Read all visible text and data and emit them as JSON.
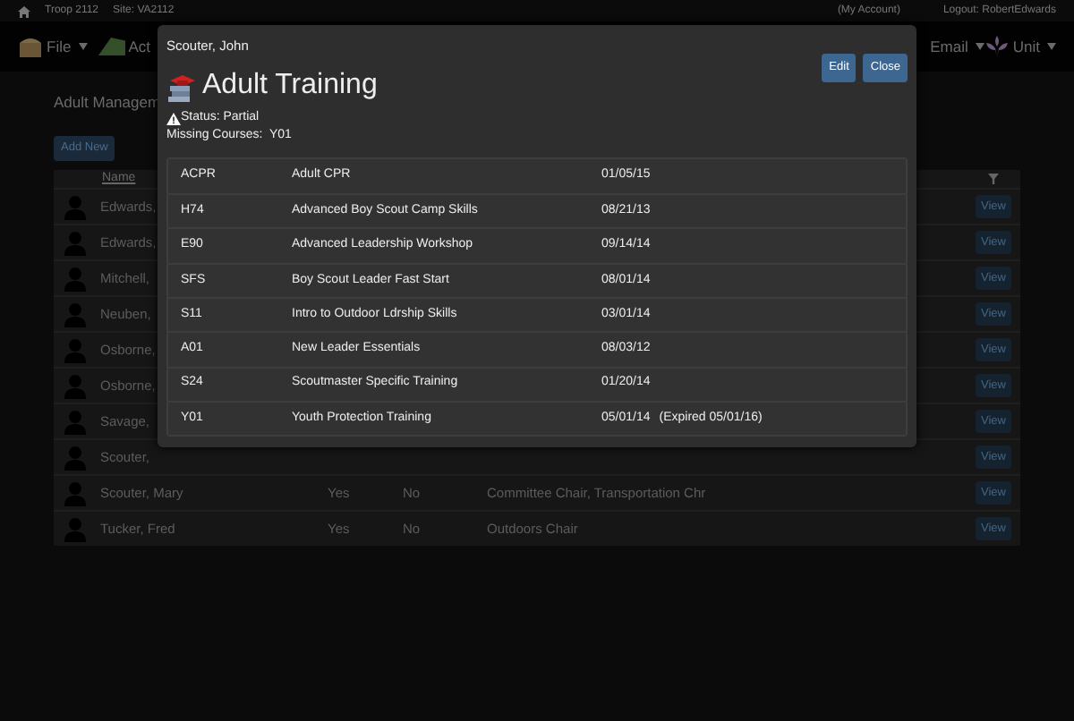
{
  "top_bar": {
    "troop": "Troop 2112",
    "site": "Site: VA2112",
    "account": "(My Account)",
    "logout": "Logout: RobertEdwards"
  },
  "nav": [
    {
      "label": "File",
      "kind": "chest",
      "caret": true
    },
    {
      "label": "Act",
      "kind": "tent",
      "caret": false
    },
    {
      "label": "Email",
      "kind": "plain",
      "caret": true
    },
    {
      "label": "Unit",
      "kind": "emblem",
      "caret": true
    }
  ],
  "page": {
    "heading": "Adult Managem",
    "add_button": "Add New",
    "name_column": "Name"
  },
  "rows": [
    {
      "name": "Edwards,",
      "view": "View"
    },
    {
      "name": "Edwards,",
      "view": "View"
    },
    {
      "name": "Mitchell,",
      "view": "View"
    },
    {
      "name": "Neuben,",
      "view": "View"
    },
    {
      "name": "Osborne,",
      "view": "View"
    },
    {
      "name": "Osborne,",
      "view": "View"
    },
    {
      "name": "Savage,",
      "view": "View"
    },
    {
      "name": "Scouter,",
      "view": "View"
    },
    {
      "name": "Scouter, Mary",
      "column_3": "Yes",
      "column_4": "No",
      "position": "Committee Chair, Transportation Chr",
      "view": "View"
    },
    {
      "name": "Tucker, Fred",
      "column_3": "Yes",
      "column_4": "No",
      "position": "Outdoors Chair",
      "view": "View"
    }
  ],
  "modal": {
    "person": "Scouter, John",
    "buttons": [
      "Edit",
      "Close"
    ],
    "title": "Adult Training",
    "status": "Status: Partial",
    "missing": "Missing Courses:  Y01",
    "courses": [
      {
        "code": "ACPR",
        "name": "Adult CPR",
        "date": "01/05/15"
      },
      {
        "code": "H74",
        "name": "Advanced Boy Scout Camp Skills",
        "date": "08/21/13"
      },
      {
        "code": "E90",
        "name": "Advanced Leadership Workshop",
        "date": "09/14/14"
      },
      {
        "code": "SFS",
        "name": "Boy Scout Leader Fast Start",
        "date": "08/01/14"
      },
      {
        "code": "S11",
        "name": "Intro to Outdoor Ldrship Skills",
        "date": "03/01/14"
      },
      {
        "code": "A01",
        "name": "New Leader Essentials",
        "date": "08/03/12"
      },
      {
        "code": "S24",
        "name": "Scoutmaster Specific Training",
        "date": "01/20/14"
      },
      {
        "code": "Y01",
        "name": "Youth Protection Training",
        "date": "05/01/14",
        "note": "(Expired 05/01/16)"
      }
    ]
  }
}
